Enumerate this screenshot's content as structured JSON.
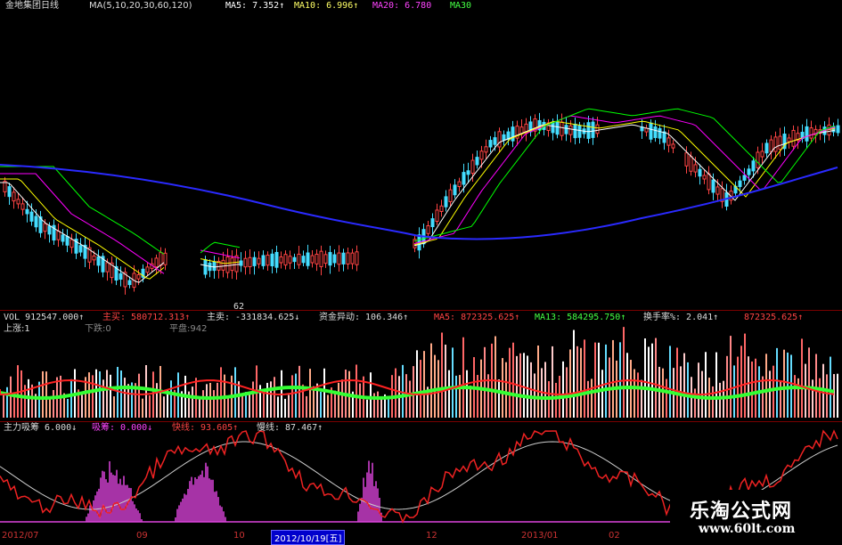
{
  "price_panel": {
    "title": "金地集团日线",
    "ma_label": "MA(5,10,20,30,60,120)",
    "ma5": "MA5: 7.352↑",
    "ma10": "MA10: 6.996↑",
    "ma20": "MA20: 6.780",
    "ma30": "MA30",
    "low_marker": "62",
    "colors": {
      "ma5": "#ffffff",
      "ma10": "#ffff00",
      "ma20": "#ff00ff",
      "ma30": "#00ff00",
      "ma60": "#ffffff",
      "ma120": "#2a2aff",
      "up": "#ff4444",
      "down": "#44ddff"
    }
  },
  "vol_panel": {
    "vol": "VOL 912547.000↑",
    "main_buy": "主买: 580712.313↑",
    "main_sell": "主卖: -331834.625↓",
    "flow": "资金异动: 106.346↑",
    "ma5": "MA5: 872325.625↑",
    "ma13": "MA13: 584295.750↑",
    "turnover": "换手率%: 2.041↑",
    "turnover2": "872325.625↑",
    "rise": "上涨:1",
    "fall": "下跌:0",
    "flat": "平盘:942"
  },
  "ind_panel": {
    "name": "主力吸筹 6.000↓",
    "absorb": "吸筹: 0.000↓",
    "fast": "快线: 93.605↑",
    "slow": "慢线: 87.467↑"
  },
  "dates": [
    "2012/07",
    "09",
    "10",
    "2012/10/19[五]",
    "12",
    "2013/01",
    "02"
  ],
  "watermark": {
    "line1": "乐淘公式网",
    "line2": "www.60lt.com"
  }
}
